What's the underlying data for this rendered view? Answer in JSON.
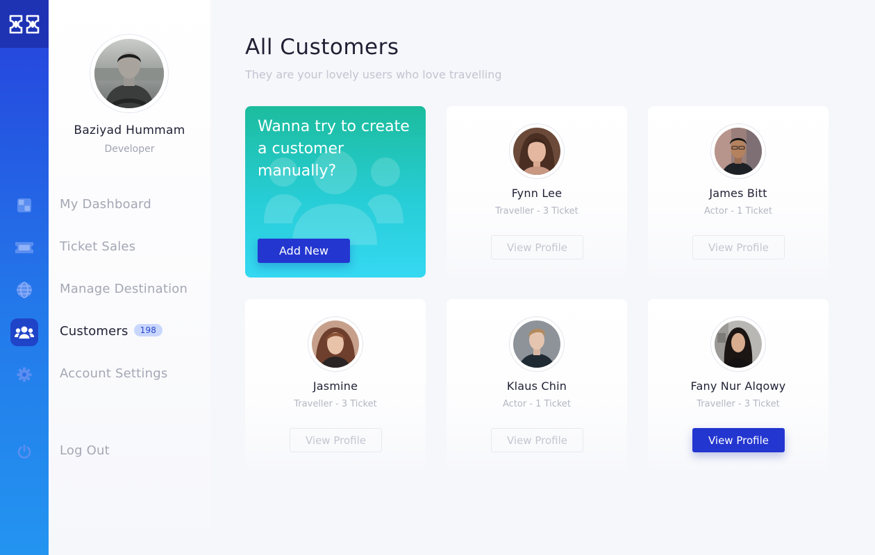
{
  "brand": {
    "logo_icon": "ticket-logo-icon",
    "colors": {
      "primary": "#2336d0",
      "rail_top": "#2640dc",
      "rail_bottom": "#2394f0",
      "promo_start": "#1cbc9d",
      "promo_end": "#35d8f2"
    }
  },
  "rail": {
    "icons": [
      "dashboard-icon",
      "ticket-icon",
      "globe-icon",
      "users-icon",
      "gear-icon",
      "power-icon"
    ],
    "active": "users-icon"
  },
  "profile": {
    "name": "Baziyad Hummam",
    "role": "Developer"
  },
  "nav": {
    "items": [
      {
        "label": "My Dashboard"
      },
      {
        "label": "Ticket Sales"
      },
      {
        "label": "Manage Destination"
      },
      {
        "label": "Customers",
        "badge": "198",
        "active": true
      },
      {
        "label": "Account Settings"
      }
    ],
    "logout": "Log Out"
  },
  "page": {
    "title": "All Customers",
    "subtitle": "They are your lovely users who love travelling"
  },
  "promo": {
    "text": "Wanna try to create a customer manually?",
    "button": "Add New",
    "icon": "users-group-icon"
  },
  "customers": [
    {
      "name": "Fynn Lee",
      "meta": "Traveller - 3 Ticket",
      "button": "View Profile",
      "active": false
    },
    {
      "name": "James Bitt",
      "meta": "Actor - 1 Ticket",
      "button": "View Profile",
      "active": false
    },
    {
      "name": "Jasmine",
      "meta": "Traveller - 3 Ticket",
      "button": "View Profile",
      "active": false
    },
    {
      "name": "Klaus Chin",
      "meta": "Actor - 1 Ticket",
      "button": "View Profile",
      "active": false
    },
    {
      "name": "Fany Nur Alqowy",
      "meta": "Traveller - 3 Ticket",
      "button": "View Profile",
      "active": true
    }
  ]
}
